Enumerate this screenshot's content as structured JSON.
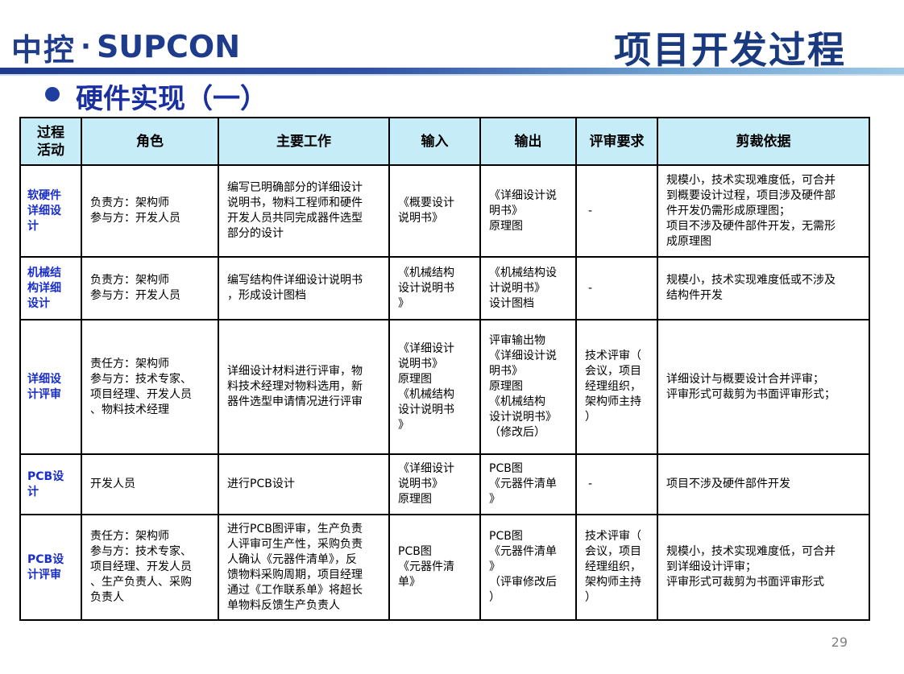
{
  "header": {
    "logo_cn": "中控",
    "logo_dot": "·",
    "logo_en": "SUPCON",
    "title": "项目开发过程"
  },
  "section": {
    "subtitle": "硬件实现（一）"
  },
  "table": {
    "headers": [
      "过程\n活动",
      "角色",
      "主要工作",
      "输入",
      "输出",
      "评审要求",
      "剪裁依据"
    ],
    "rows": [
      {
        "activity": "软硬件\n详细设\n计",
        "role": "负责方：架构师\n参与方：开发人员",
        "work": "编写已明确部分的详细设计\n说明书，物料工程师和硬件\n开发人员共同完成器件选型\n部分的设计",
        "input": "《概要设计\n说明书》",
        "output": "《详细设计说\n明书》\n原理图",
        "review": "-",
        "basis": "规模小，技术实现难度低，可合并\n到概要设计过程，项目涉及硬件部\n件开发仍需形成原理图；\n项目不涉及硬件部件开发，无需形\n成原理图"
      },
      {
        "activity": "机械结\n构详细\n设计",
        "role": "负责方：架构师\n参与方：开发人员",
        "work": "编写结构件详细设计说明书\n，形成设计图档",
        "input": "《机械结构\n设计说明书\n》",
        "output": "《机械结构设\n计说明书》\n设计图档",
        "review": "-",
        "basis": "规模小，技术实现难度低或不涉及\n结构件开发"
      },
      {
        "activity": "详细设\n计评审",
        "role": "责任方：架构师\n参与方：技术专家、\n项目经理、开发人员\n、物料技术经理",
        "work": "详细设计材料进行评审，物\n料技术经理对物料选用，新\n器件选型申请情况进行评审",
        "input": "《详细设计\n说明书》\n原理图\n《机械结构\n设计说明书\n》",
        "output": "评审输出物\n《详细设计说\n明书》\n原理图\n《机械结构\n设计说明书》\n（修改后）",
        "review": "技术评审（\n会议，项目\n经理组织，\n架构师主持\n）",
        "basis": "详细设计与概要设计合并评审；\n评审形式可裁剪为书面评审形式；"
      },
      {
        "activity": "PCB设\n计",
        "role": "开发人员",
        "work": "进行PCB设计",
        "input": "《详细设计\n说明书》\n原理图",
        "output": "PCB图\n《元器件清单\n》",
        "review": "-",
        "basis": "项目不涉及硬件部件开发"
      },
      {
        "activity": "PCB设\n计评审",
        "role": "责任方：架构师\n参与方：技术专家、\n项目经理、开发人员\n、生产负责人、采购\n负责人",
        "work": "进行PCB图评审，生产负责\n人评审可生产性，采购负责\n人确认《元器件清单》，反\n馈物料采购周期，项目经理\n通过《工作联系单》将超长\n单物料反馈生产负责人",
        "input": "PCB图\n《元器件清\n单》",
        "output": "PCB图\n《元器件清单\n》\n（评审修改后\n）",
        "review": "技术评审（\n会议，项目\n经理组织，\n架构师主持\n）",
        "basis": "规模小，技术实现难度低，可合并\n到详细设计评审；\n评审形式可裁剪为书面评审形式"
      }
    ]
  },
  "footer": {
    "page_number": "29"
  }
}
